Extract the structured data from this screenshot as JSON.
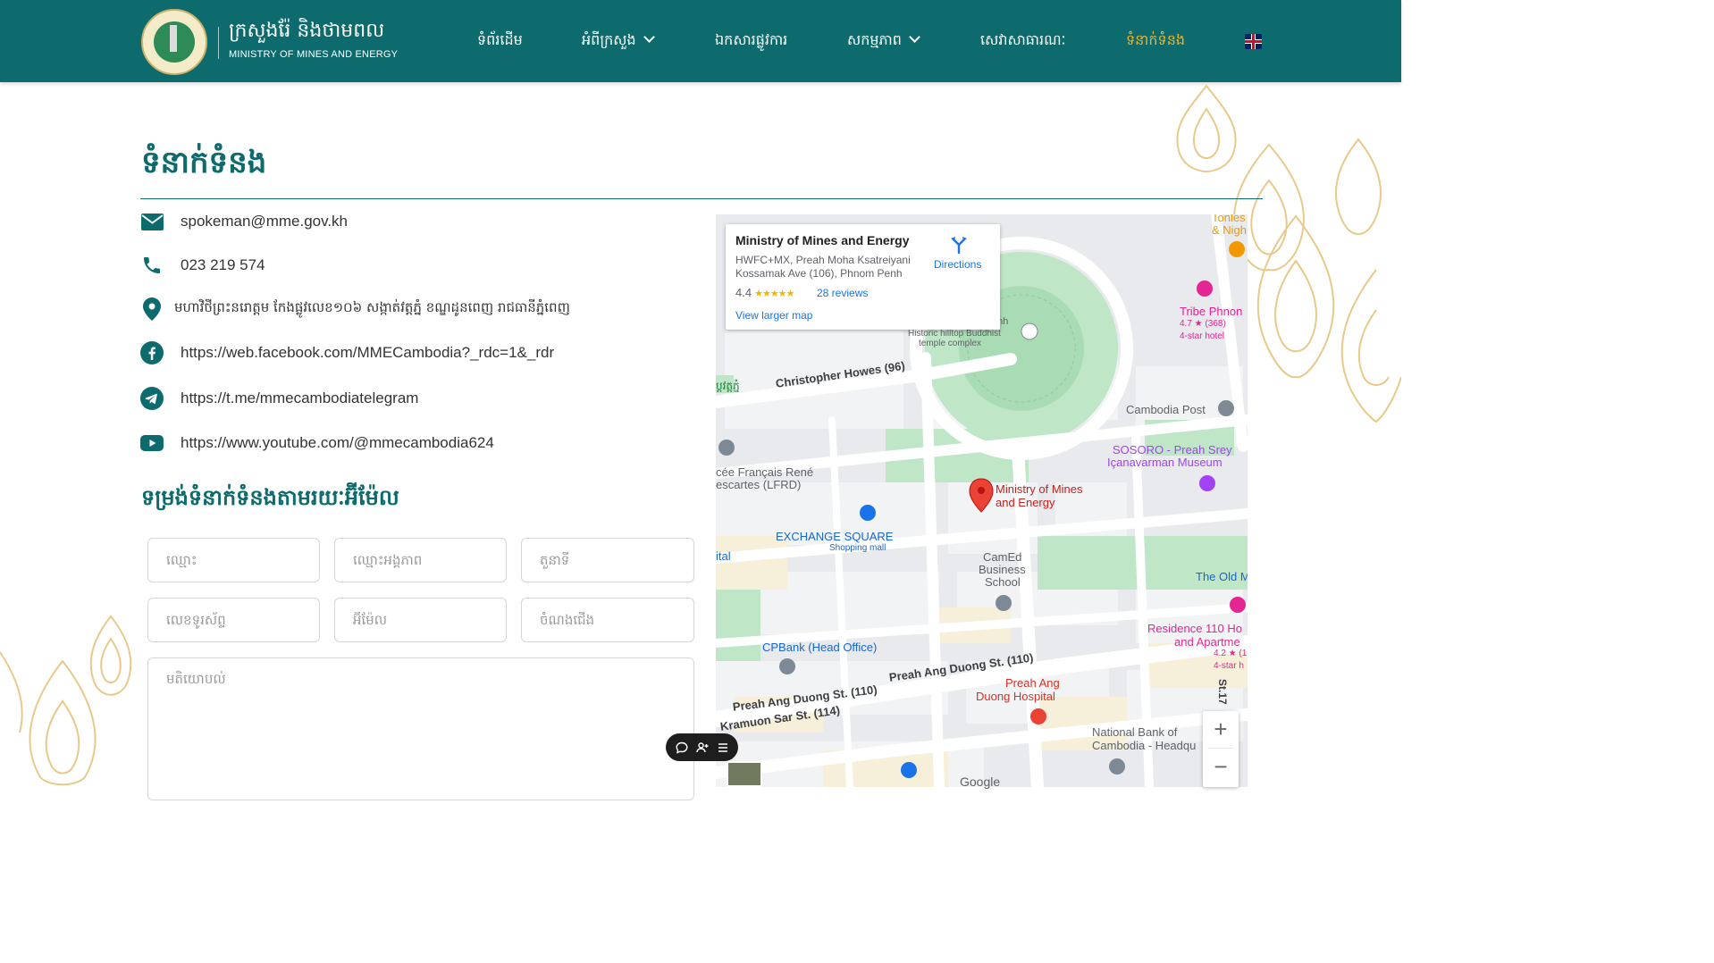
{
  "header": {
    "brand_kh": "ក្រសួងរ៉ែ និងថាមពល",
    "brand_en": "MINISTRY OF MINES AND ENERGY",
    "nav": [
      {
        "label": "ទំព័រដើម",
        "dropdown": false,
        "active": false
      },
      {
        "label": "អំពីក្រសួង",
        "dropdown": true,
        "active": false
      },
      {
        "label": "ឯកសារផ្លូវការ",
        "dropdown": false,
        "active": false
      },
      {
        "label": "សកម្មភាព",
        "dropdown": true,
        "active": false
      },
      {
        "label": "សេវាសាធារណៈ",
        "dropdown": false,
        "active": false
      },
      {
        "label": "ទំនាក់ទំនង",
        "dropdown": false,
        "active": true
      }
    ],
    "language_icon": "uk-flag-icon"
  },
  "page": {
    "title": "ទំនាក់ទំនង"
  },
  "contact": {
    "email": "spokeman@mme.gov.kh",
    "phone": "023 219 574",
    "address": "មហាវិថីព្រះនរោត្តម កែងផ្លូវលេខ១០៦ សង្កាត់វត្តភ្នំ ខណ្ឌដូនពេញ រាជធានីភ្នំពេញ",
    "facebook": "https://web.facebook.com/MMECambodia?_rdc=1&_rdr",
    "telegram": "https://t.me/mmecambodiatelegram",
    "youtube": "https://www.youtube.com/@mmecambodia624"
  },
  "form": {
    "title": "ទម្រង់ទំនាក់ទំនងតាមរយៈអ៊ីម៉ែល",
    "placeholders": {
      "name": "ឈ្មោះ",
      "organization": "ឈ្មោះអង្គភាព",
      "position": "តួនាទី",
      "phone": "លេខទូរស័ព្ទ",
      "email": "អ៊ីម៉ែល",
      "subject": "ចំណងជើង",
      "message": "មតិយោបល់"
    }
  },
  "map": {
    "place_title": "Ministry of Mines and Energy",
    "address": "HWFC+MX, Preah Moha Ksatreiyani Kossamak Ave (106), Phnom Penh",
    "rating": "4.4",
    "stars": "★★★★★",
    "reviews": "28 reviews",
    "larger_map": "View larger map",
    "directions": "Directions",
    "labels": {
      "christopher_howes": "Christopher Howes (96)",
      "historic": "Historic hilltop Buddhist",
      "temple_complex": "temple complex",
      "enh": "enh",
      "cambodia_post": "Cambodia Post",
      "sosoro_1": "SOSORO - Preah Srey",
      "sosoro_2": "Içanavarman Museum",
      "mme_1": "Ministry of Mines",
      "mme_2": "and Energy",
      "lycee_1": "cée Français René",
      "lycee_2": "escartes (LFRD)",
      "exchange": "EXCHANGE SQUARE",
      "shopping": "Shopping mall",
      "camed_1": "CamEd",
      "camed_2": "Business",
      "camed_3": "School",
      "old_m": "The Old M",
      "residence_1": "Residence 110 Ho",
      "residence_2": "and Apartme",
      "residence_rating": "4.2 ★ (1",
      "residence_star": "4-star h",
      "tribe_1": "Tribe Phnon",
      "tribe_rating": "4.7 ★ (368)",
      "tribe_star": "4-star hotel",
      "tonles_1": "Tonles",
      "tonles_2": "& Nigh",
      "cpbank": "CPBank (Head Office)",
      "preah_ang_1": "Preah Ang Duong St. (110)",
      "preah_ang_2": "Preah Ang Duong St. (110)",
      "kramuon": "Kramuon Sar St. (114)",
      "hospital_1": "Preah Ang",
      "hospital_2": "Duong Hospital",
      "national_bank_1": "National Bank of",
      "national_bank_2": "Cambodia - Headqu",
      "ital": "ital",
      "wat_kh": "ប្តវត្តភ្នំ",
      "st_17": "St.17",
      "google": "Google"
    },
    "zoom_in": "+",
    "zoom_out": "−"
  },
  "floating_toolbar": {
    "icons": [
      "chat-icon",
      "user-add-icon",
      "menu-icon"
    ]
  },
  "colors": {
    "primary": "#0d6b6e",
    "accent": "#f0b429",
    "link_blue": "#1a73e8",
    "ornament": "#e9c98a"
  }
}
